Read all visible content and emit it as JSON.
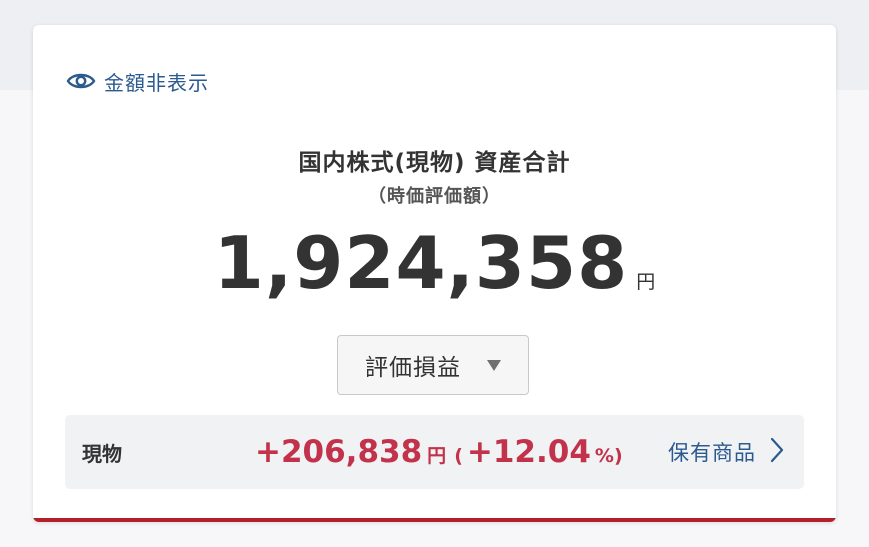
{
  "toggle": {
    "icon": "eye-icon",
    "label": "金額非表示"
  },
  "summary": {
    "title": "国内株式(現物) 資産合計",
    "subtitle": "（時価評価額）",
    "total_amount": "1,924,358",
    "total_unit": "円"
  },
  "dropdown": {
    "selected": "評価損益"
  },
  "row": {
    "label": "現物",
    "gain_value": "+206,838",
    "gain_unit": "円",
    "paren_open": "(",
    "percent_value": "+12.04",
    "percent_close": "%)",
    "link_label": "保有商品",
    "link_icon": "chevron-right-icon"
  },
  "colors": {
    "accent_blue": "#2b5a8f",
    "gain_red": "#c2324a",
    "bar_red": "#b4202a"
  }
}
